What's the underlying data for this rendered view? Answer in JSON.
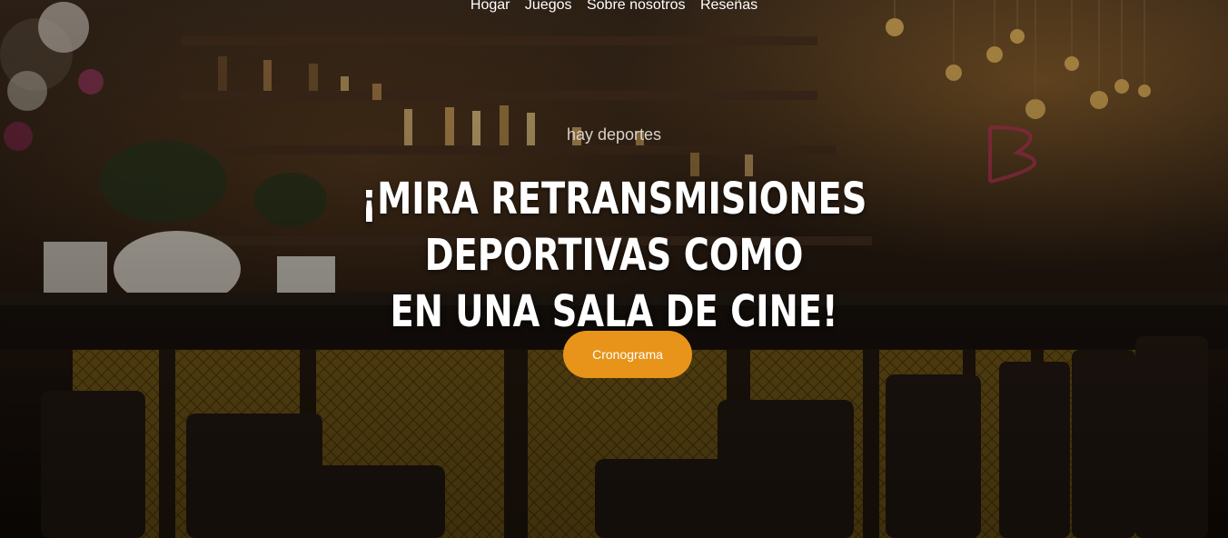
{
  "nav": {
    "items": [
      "Hogar",
      "Juegos",
      "Sobre nosotros",
      "Reseñas"
    ]
  },
  "hero": {
    "eyebrow": "hay deportes",
    "headline_line1": "¡MIRA RETRANSMISIONES DEPORTIVAS COMO",
    "headline_line2": "EN UNA SALA DE CINE!",
    "cta_label": "Cronograma",
    "background": "bar-interior-photo"
  },
  "colors": {
    "accent": "#e8941a",
    "text": "#ffffff",
    "overlay": "#120c07"
  }
}
